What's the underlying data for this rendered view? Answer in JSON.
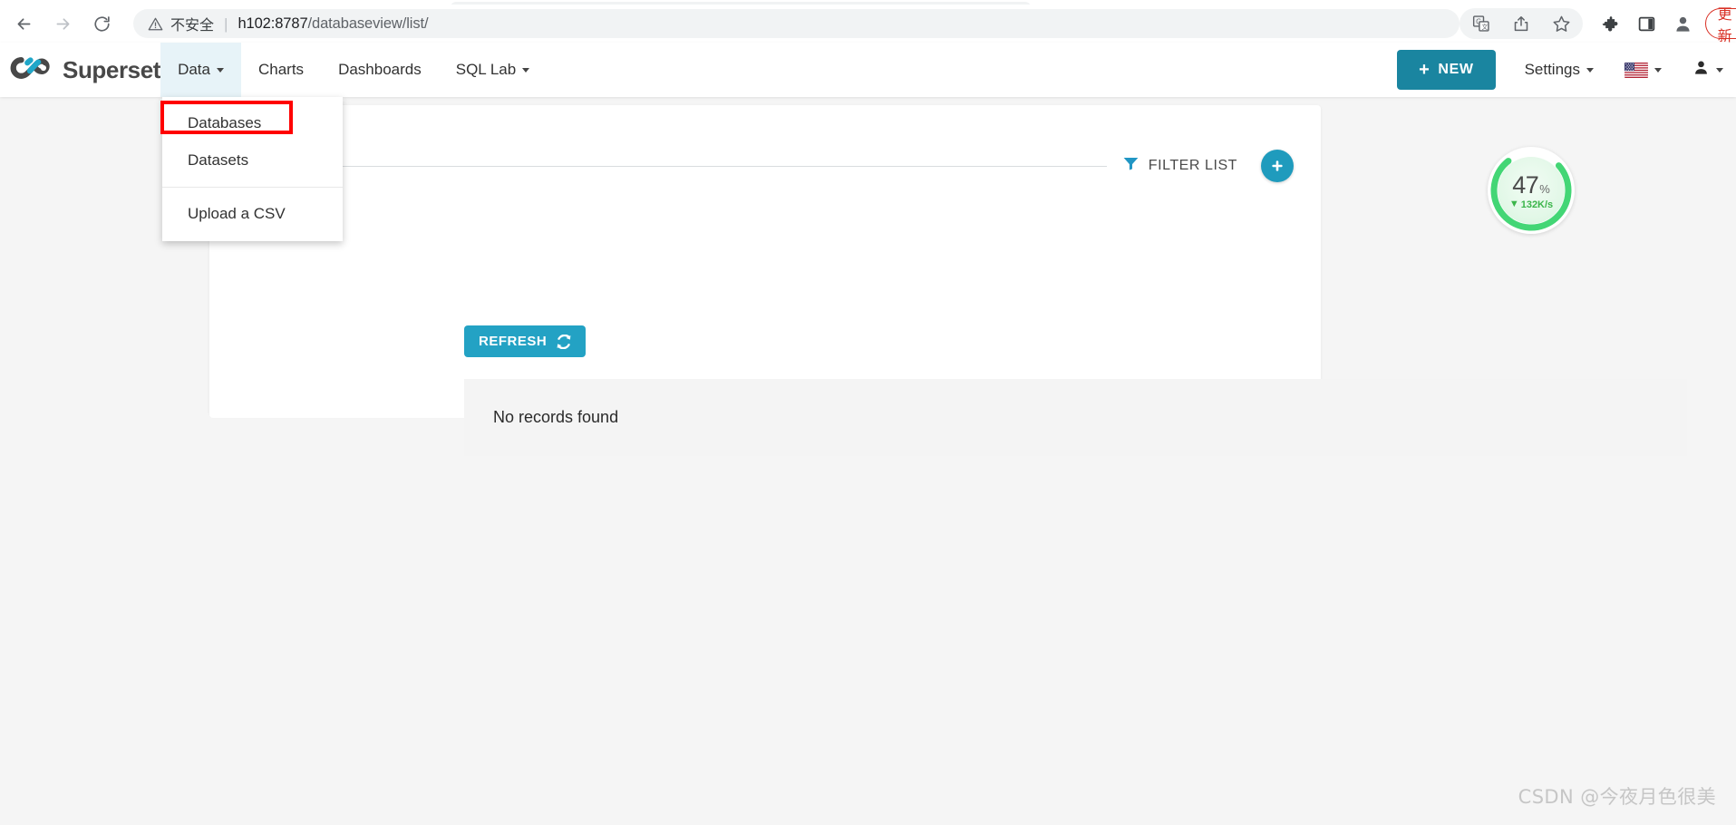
{
  "browser": {
    "back_icon": "back-arrow-icon",
    "forward_icon": "forward-arrow-icon",
    "reload_icon": "reload-icon",
    "security_warning_icon": "warning-triangle-icon",
    "security_label": "不安全",
    "url_separator": "|",
    "url_host": "h102:8787",
    "url_path": "/databaseview/list/",
    "toolbar_icons": [
      "translate-icon",
      "share-icon",
      "bookmark-star-icon",
      "extensions-puzzle-icon",
      "side-panel-icon",
      "profile-avatar-icon"
    ],
    "update_label": "更新",
    "menu_icon": "three-dot-menu-icon",
    "update_color": "#d93025"
  },
  "superset": {
    "brand": "Superset",
    "brand_logo_icon": "superset-infinity-logo",
    "brand_accent": "#20a7c9",
    "nav_items": [
      {
        "label": "Data",
        "has_caret": true,
        "active": true
      },
      {
        "label": "Charts",
        "has_caret": false,
        "active": false
      },
      {
        "label": "Dashboards",
        "has_caret": false,
        "active": false
      },
      {
        "label": "SQL Lab",
        "has_caret": true,
        "active": false
      }
    ],
    "new_button": {
      "label": "NEW",
      "plus": "+",
      "color": "#1a85a0"
    },
    "settings_label": "Settings",
    "flag_icon": "us-flag-icon",
    "user_icon": "user-avatar-icon"
  },
  "dropdown": {
    "items": [
      {
        "label": "Databases",
        "highlighted": true
      },
      {
        "label": "Datasets",
        "highlighted": false
      }
    ],
    "secondary_items": [
      {
        "label": "Upload a CSV"
      }
    ],
    "highlight_color": "#ff0000"
  },
  "content": {
    "filter_icon": "filter-funnel-icon",
    "filter_list_label": "FILTER LIST",
    "add_button_icon": "plus-icon",
    "add_button_label": "+",
    "refresh_label": "REFRESH",
    "refresh_icon": "refresh-sync-icon",
    "empty_message": "No records found",
    "accent_color": "#23a2c4"
  },
  "network_gauge": {
    "percent_value": "47",
    "percent_symbol": "%",
    "download_arrow": "▼",
    "speed": "132K/s",
    "ring_color": "#43d675",
    "text_color": "#4a4a4a"
  },
  "watermark": {
    "text": "CSDN @今夜月色很美"
  }
}
